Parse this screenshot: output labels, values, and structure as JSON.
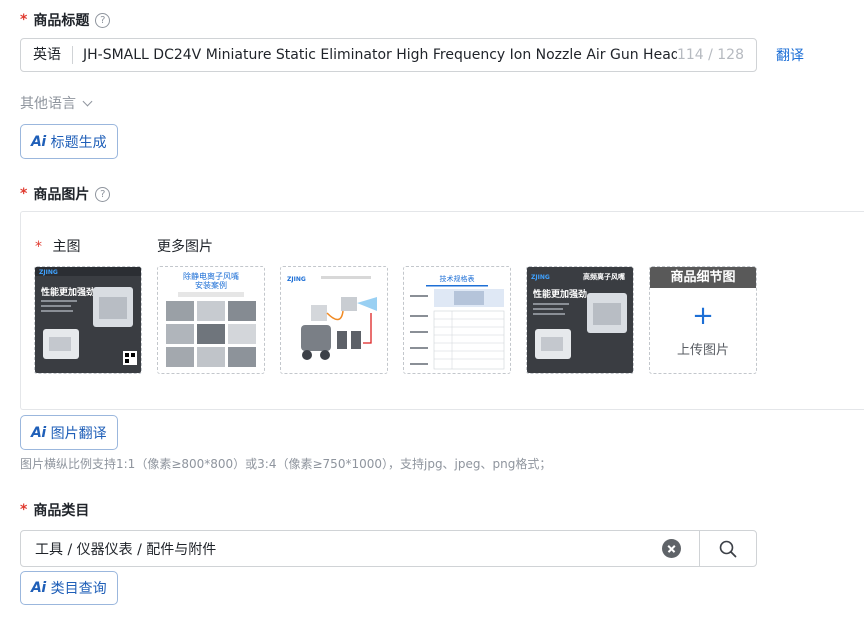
{
  "title_section": {
    "label": "商品标题",
    "help": "?",
    "lang": "英语",
    "value": "JH-SMALL  DC24V Miniature Static Eliminator High Frequency Ion Nozzle Air Gun Head",
    "counter": "114 / 128",
    "translate": "翻译",
    "other_lang": "其他语言",
    "ai_button": "标题生成"
  },
  "image_section": {
    "label": "商品图片",
    "help": "?",
    "main_label": "主图",
    "more_label": "更多图片",
    "thumbs": [
      {
        "name": "main-product-image",
        "banner_brand": "ZJING",
        "banner_text": "性能更加强劲"
      },
      {
        "name": "install-cases-image",
        "title1": "除静电离子风嘴",
        "title2": "安装案例"
      },
      {
        "name": "air-connection-image",
        "brand": "ZJING"
      },
      {
        "name": "spec-sheet-image",
        "title": "技术规格表"
      },
      {
        "name": "product-banner-image",
        "brand": "ZJING",
        "text": "高频离子风嘴",
        "banner_text": "性能更加强劲"
      }
    ],
    "detail_header": "商品细节图",
    "upload_label": "上传图片",
    "ai_button": "图片翻译",
    "hint": "图片横纵比例支持1:1（像素≥800*800）或3:4（像素≥750*1000），支持jpg、jpeg、png格式；"
  },
  "category_section": {
    "label": "商品类目",
    "value": "工具 / 仪器仪表 / 配件与附件",
    "ai_button": "类目查询"
  },
  "icons": {
    "ai": "Ai",
    "required": "*",
    "plus": "+"
  },
  "colors": {
    "accent": "#1d6fd6",
    "required": "#e03a2f",
    "dark_banner": "#595959"
  }
}
